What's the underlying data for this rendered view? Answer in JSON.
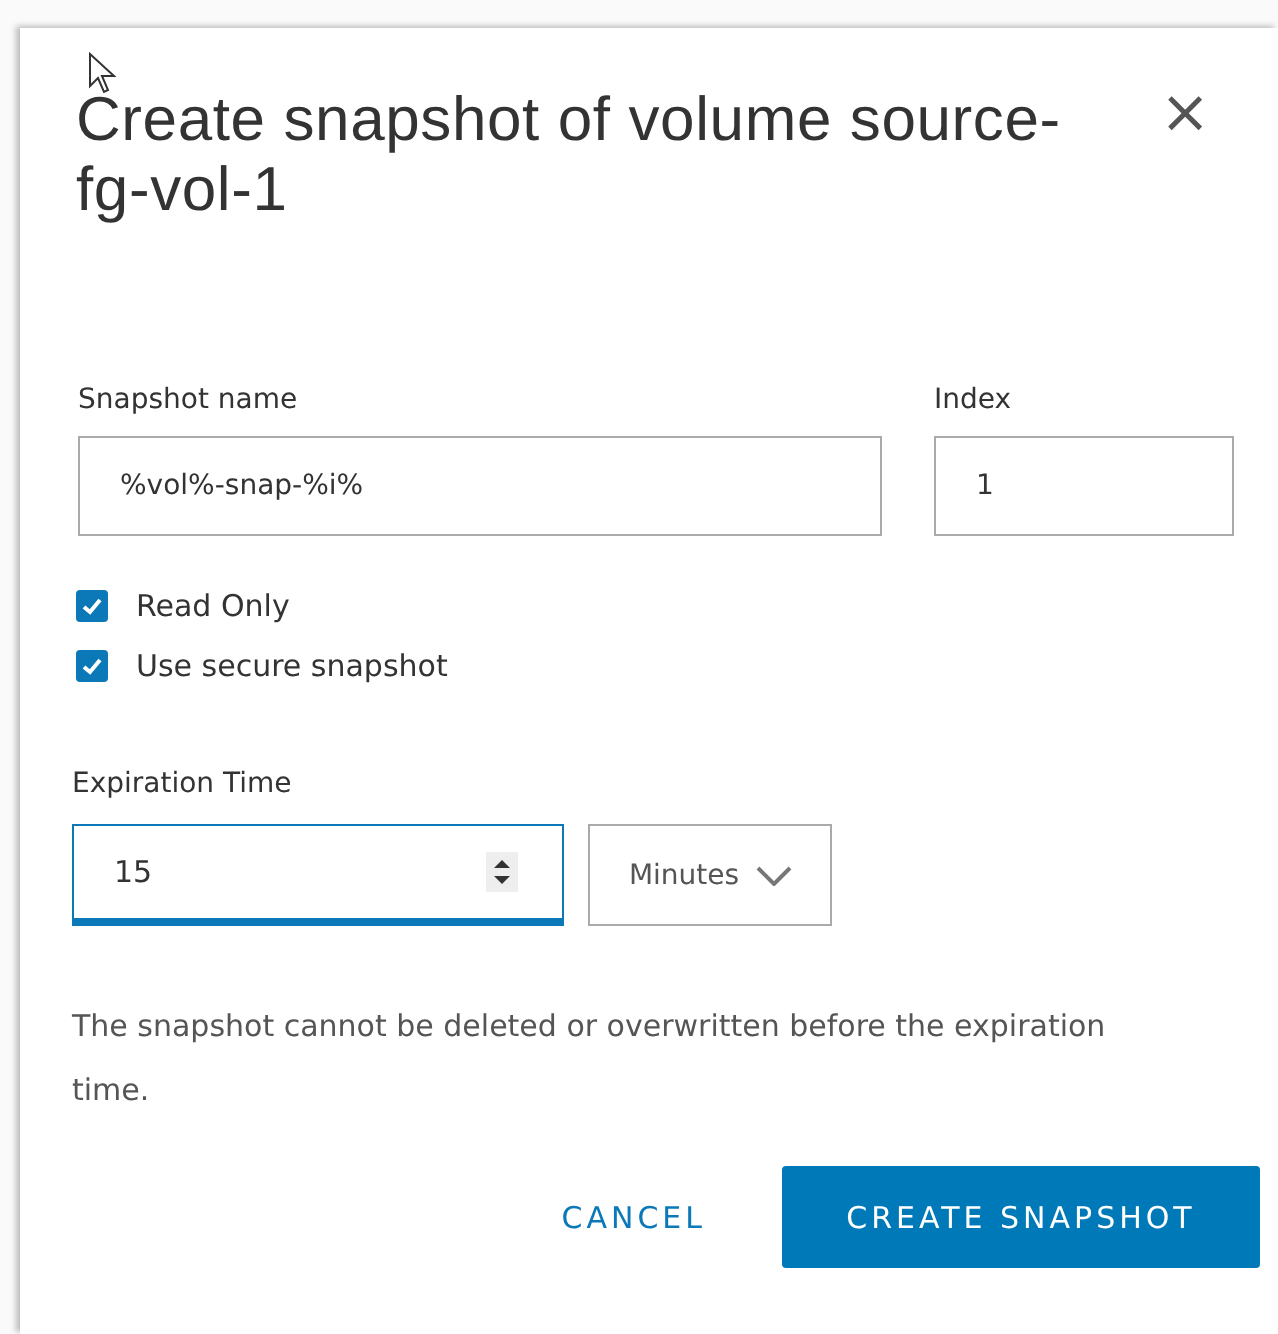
{
  "dialog": {
    "title": "Create snapshot of volume source-fg-vol-1",
    "close": "×"
  },
  "fields": [
    {
      "label": "Snapshot name",
      "value": "%vol%-snap-%i%"
    },
    {
      "label": "Index",
      "value": "1"
    }
  ],
  "options": [
    {
      "label": "Read Only",
      "checked": true
    },
    {
      "label": "Use secure snapshot",
      "checked": true
    }
  ],
  "expiration": {
    "label": "Expiration Time",
    "value": "15",
    "focused": true,
    "unit": "Minutes"
  },
  "note": "The snapshot cannot be deleted or overwritten before the expiration time.",
  "buttons": [
    {
      "label": "CANCEL",
      "kind": "flat"
    },
    {
      "label": "CREATE SNAPSHOT",
      "kind": "primary"
    }
  ]
}
